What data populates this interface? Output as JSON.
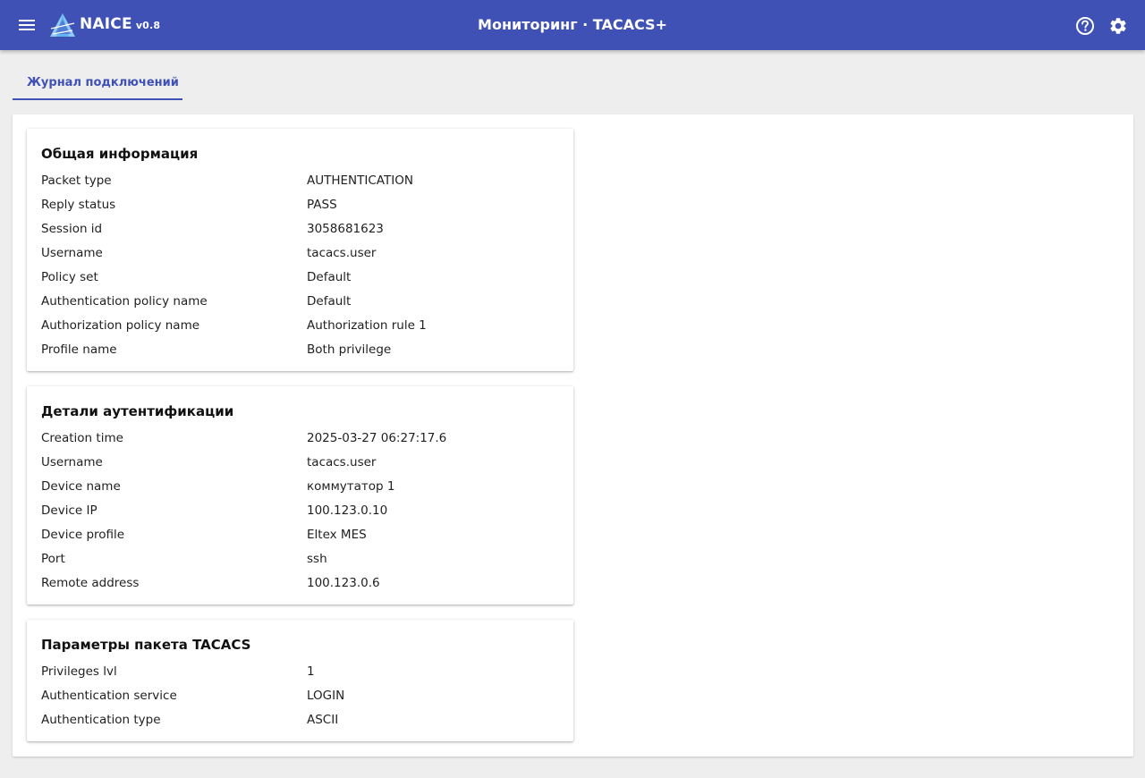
{
  "app": {
    "name": "NAICE",
    "version": "v0.8",
    "title": "Мониторинг · TACACS+"
  },
  "colors": {
    "primary": "#3f51b5",
    "background": "#eeeeee",
    "surface": "#ffffff"
  },
  "icons": {
    "menu": "menu-icon",
    "logo": "naice-logo-icon",
    "help": "help-circle-icon",
    "settings": "gear-icon"
  },
  "tabs": [
    {
      "label": "Журнал подключений",
      "active": true
    }
  ],
  "sections": [
    {
      "title": "Общая информация",
      "rows": [
        {
          "label": "Packet type",
          "value": "AUTHENTICATION"
        },
        {
          "label": "Reply status",
          "value": "PASS"
        },
        {
          "label": "Session id",
          "value": "3058681623"
        },
        {
          "label": "Username",
          "value": "tacacs.user"
        },
        {
          "label": "Policy set",
          "value": "Default"
        },
        {
          "label": "Authentication policy name",
          "value": "Default"
        },
        {
          "label": "Authorization policy name",
          "value": "Authorization rule 1"
        },
        {
          "label": "Profile name",
          "value": "Both privilege"
        }
      ]
    },
    {
      "title": "Детали аутентификации",
      "rows": [
        {
          "label": "Creation time",
          "value": "2025-03-27 06:27:17.6"
        },
        {
          "label": "Username",
          "value": "tacacs.user"
        },
        {
          "label": "Device name",
          "value": "коммутатор 1"
        },
        {
          "label": "Device IP",
          "value": "100.123.0.10"
        },
        {
          "label": "Device profile",
          "value": "Eltex MES"
        },
        {
          "label": "Port",
          "value": "ssh"
        },
        {
          "label": "Remote address",
          "value": "100.123.0.6"
        }
      ]
    },
    {
      "title": "Параметры пакета TACACS",
      "rows": [
        {
          "label": "Privileges lvl",
          "value": "1"
        },
        {
          "label": "Authentication service",
          "value": "LOGIN"
        },
        {
          "label": "Authentication type",
          "value": "ASCII"
        }
      ]
    }
  ]
}
